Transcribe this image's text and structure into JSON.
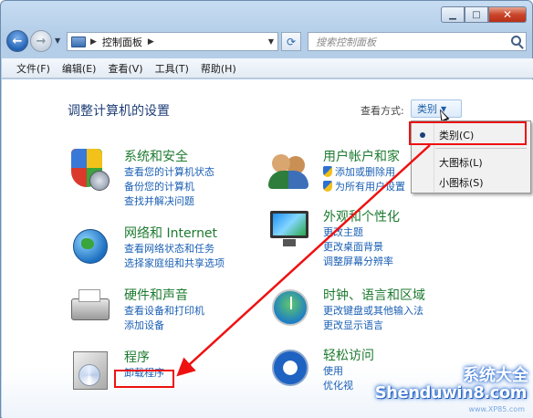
{
  "address": {
    "path": "控制面板",
    "separator": "▶"
  },
  "search": {
    "placeholder": "搜索控制面板"
  },
  "menu": [
    "文件(F)",
    "编辑(E)",
    "查看(V)",
    "工具(T)",
    "帮助(H)"
  ],
  "header": {
    "title": "调整计算机的设置",
    "view_by_label": "查看方式:",
    "view_by_value": "类别"
  },
  "view_menu": {
    "items": [
      "类别(C)",
      "大图标(L)",
      "小图标(S)"
    ],
    "selected": "类别(C)"
  },
  "categories": [
    {
      "title": "系统和安全",
      "icon": "security-shield-icon",
      "links": [
        "查看您的计算机状态",
        "备份您的计算机",
        "查找并解决问题"
      ]
    },
    {
      "title": "网络和 Internet",
      "icon": "network-globe-icon",
      "links": [
        "查看网络状态和任务",
        "选择家庭组和共享选项"
      ]
    },
    {
      "title": "硬件和声音",
      "icon": "printer-icon",
      "links": [
        "查看设备和打印机",
        "添加设备"
      ]
    },
    {
      "title": "程序",
      "icon": "programs-box-icon",
      "links": [
        "卸载程序"
      ]
    },
    {
      "title": "用户帐户和家",
      "icon": "users-icon",
      "links": [
        "添加或删除用",
        "为所有用户设置"
      ],
      "shield_links": [
        true,
        true
      ]
    },
    {
      "title": "外观和个性化",
      "icon": "monitor-icon",
      "links": [
        "更改主题",
        "更改桌面背景",
        "调整屏幕分辨率"
      ]
    },
    {
      "title": "时钟、语言和区域",
      "icon": "clock-globe-icon",
      "links": [
        "更改键盘或其他输入法",
        "更改显示语言"
      ]
    },
    {
      "title": "轻松访问",
      "icon": "ease-of-access-icon",
      "links": [
        "使用",
        "优化视"
      ]
    }
  ],
  "watermark": {
    "cn": "系统大全",
    "brand": "Shenduwin8.com",
    "url": "www.XP85.com"
  },
  "colors": {
    "title_text": "#1f3f78",
    "category_title": "#1d7a2f",
    "link": "#1a5fb4",
    "highlight": "#ee1111"
  }
}
